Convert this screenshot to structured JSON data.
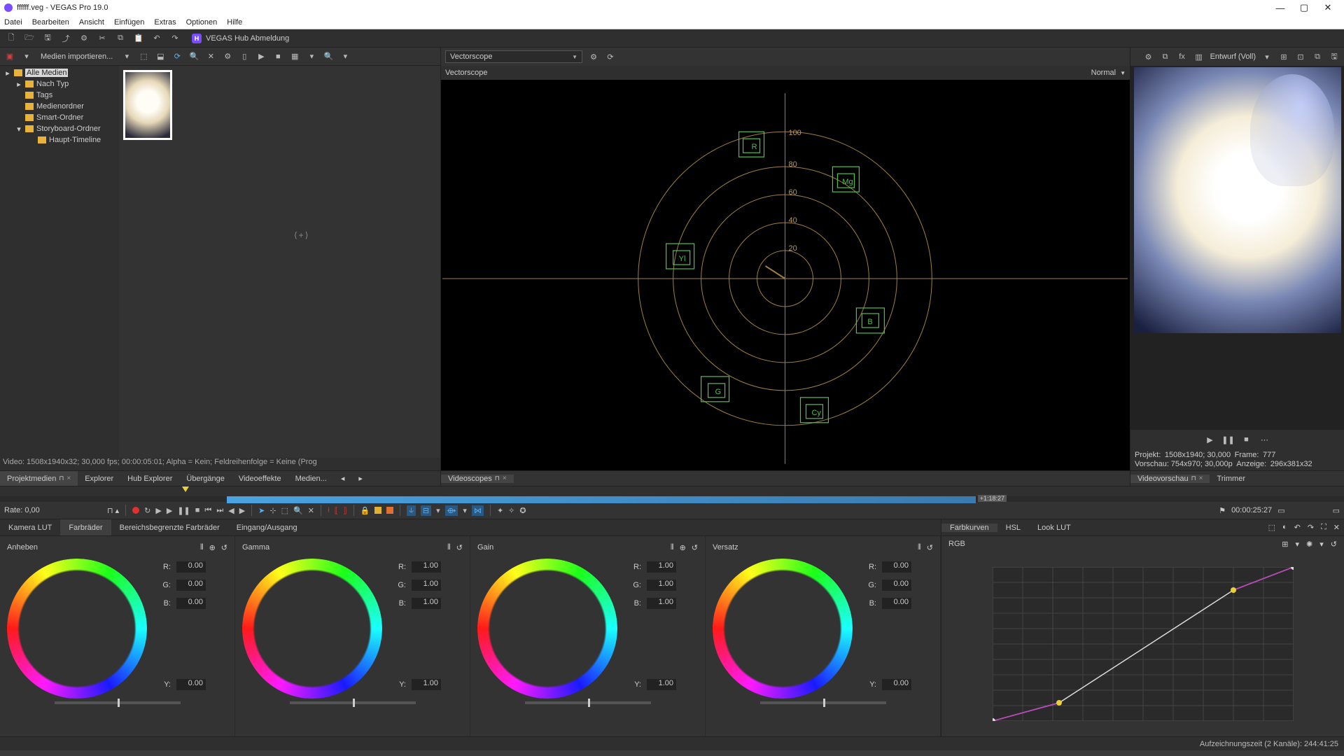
{
  "window": {
    "title": "ffffff.veg - VEGAS Pro 19.0"
  },
  "menu": [
    "Datei",
    "Bearbeiten",
    "Ansicht",
    "Einfügen",
    "Extras",
    "Optionen",
    "Hilfe"
  ],
  "hub": {
    "badge": "H",
    "label": "VEGAS Hub Abmeldung"
  },
  "media": {
    "import_label": "Medien importieren...",
    "tree": {
      "root": "Alle Medien",
      "items": [
        "Nach Typ",
        "Tags",
        "Medienordner",
        "Smart-Ordner",
        "Storyboard-Ordner"
      ],
      "sub": "Haupt-Timeline"
    },
    "status": "Video: 1508x1940x32; 30,000 fps; 00:00:05:01; Alpha = Kein; Feldreihenfolge = Keine (Prog",
    "tabs": [
      "Projektmedien",
      "Explorer",
      "Hub Explorer",
      "Übergänge",
      "Videoeffekte",
      "Medien..."
    ]
  },
  "scopes": {
    "dropdown": "Vectorscope",
    "sub_label": "Vectorscope",
    "mode": "Normal",
    "labels": {
      "r": "R",
      "mg": "Mg",
      "yl": "Yl",
      "g": "G",
      "cy": "Cy",
      "b": "B"
    },
    "rings": [
      "20",
      "40",
      "60",
      "80",
      "100"
    ],
    "tab": "Videoscopes"
  },
  "preview": {
    "quality_label": "Entwurf (Voll)",
    "info_project_label": "Projekt:",
    "info_project_val": "1508x1940; 30,000",
    "frame_label": "Frame:",
    "frame_val": "777",
    "info_preview_label": "Vorschau:",
    "info_preview_val": "754x970; 30,000p",
    "display_label": "Anzeige:",
    "display_val": "296x381x32",
    "tabs": [
      "Videovorschau",
      "Trimmer"
    ]
  },
  "timeline": {
    "rate_label": "Rate: 0,00",
    "clip_label": "+1:18:27",
    "time": "00:00:25:27"
  },
  "color": {
    "left_tabs": [
      "Kamera LUT",
      "Farbräder",
      "Bereichsbegrenzte Farbräder",
      "Eingang/Ausgang"
    ],
    "wheels": [
      {
        "name": "Anheben",
        "r": "0.00",
        "g": "0.00",
        "b": "0.00",
        "y": "0.00"
      },
      {
        "name": "Gamma",
        "r": "1.00",
        "g": "1.00",
        "b": "1.00",
        "y": "1.00"
      },
      {
        "name": "Gain",
        "r": "1.00",
        "g": "1.00",
        "b": "1.00",
        "y": "1.00"
      },
      {
        "name": "Versatz",
        "r": "0.00",
        "g": "0.00",
        "b": "0.00",
        "y": "0.00"
      }
    ],
    "rgb_labels": {
      "r": "R:",
      "g": "G:",
      "b": "B:",
      "y": "Y:"
    },
    "right_tabs": [
      "Farbkurven",
      "HSL",
      "Look LUT"
    ],
    "curve_label": "RGB"
  },
  "status": {
    "record_time": "Aufzeichnungszeit (2 Kanäle): 244:41:25"
  },
  "chart_data": {
    "type": "line",
    "title": "RGB Curve",
    "x": [
      0,
      0.22,
      0.8,
      1.0
    ],
    "y": [
      0,
      0.12,
      0.85,
      1.0
    ],
    "xlim": [
      0,
      1
    ],
    "ylim": [
      0,
      1
    ]
  }
}
